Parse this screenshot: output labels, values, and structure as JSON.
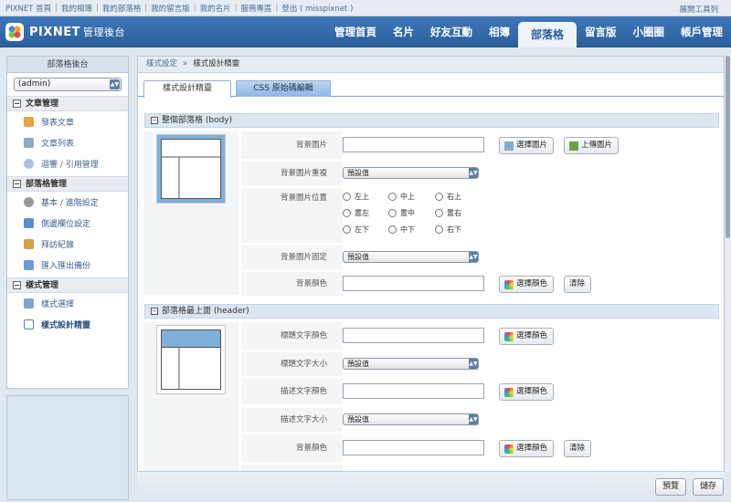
{
  "topbar": {
    "links": [
      "PIXNET 首頁",
      "我的相簿",
      "我的部落格",
      "我的留言版",
      "我的名片",
      "服務專區",
      "登出 ( misspixnet )"
    ],
    "right": "展開工具列"
  },
  "header": {
    "brand": "PIXNET",
    "brand_sub": "管理後台",
    "nav": [
      "管理首頁",
      "名片",
      "好友互動",
      "相簿",
      "部落格",
      "留言版",
      "小圈圈",
      "帳戶管理"
    ],
    "active_nav": "部落格"
  },
  "sidebar": {
    "title": "部落格後台",
    "select_value": "(admin)",
    "sections": [
      {
        "title": "文章管理",
        "items": [
          "發表文章",
          "文章列表",
          "迴響 / 引用管理"
        ]
      },
      {
        "title": "部落格管理",
        "items": [
          "基本 / 進階設定",
          "側邊欄位設定",
          "拜訪紀錄",
          "匯入匯出備份"
        ]
      },
      {
        "title": "樣式管理",
        "items": [
          "樣式選擇",
          "樣式設計精靈"
        ]
      }
    ]
  },
  "breadcrumb": {
    "parent": "樣式設定",
    "current": "樣式設計精靈"
  },
  "tabs": [
    "樣式設計精靈",
    "CSS 原始碼編輯"
  ],
  "body_section": {
    "title": "整個部落格 (body)",
    "bg_image_label": "背景圖片",
    "choose_image": "選擇圖片",
    "upload_image": "上傳圖片",
    "bg_repeat_label": "背景圖片重複",
    "bg_repeat_value": "預設值",
    "bg_pos_label": "背景圖片位置",
    "positions": [
      "左上",
      "中上",
      "右上",
      "置左",
      "置中",
      "置右",
      "左下",
      "中下",
      "右下"
    ],
    "bg_fixed_label": "背景圖片固定",
    "bg_fixed_value": "預設值",
    "bg_color_label": "背景顏色",
    "choose_color": "選擇顏色",
    "clear": "清除"
  },
  "header_section": {
    "title": "部落格最上面 (header)",
    "title_color_label": "標題文字顏色",
    "title_size_label": "標題文字大小",
    "title_size_value": "預設值",
    "desc_color_label": "描述文字顏色",
    "desc_size_label": "描述文字大小",
    "desc_size_value": "預設值",
    "bg_color_label": "背景顏色",
    "choose_color": "選擇顏色",
    "clear": "清除"
  },
  "footer": {
    "preview": "預覽",
    "save": "儲存"
  },
  "colors": {
    "header_bg": "#3a73b3",
    "accent": "#2d5e99",
    "preview_blue": "#7eb0da"
  }
}
